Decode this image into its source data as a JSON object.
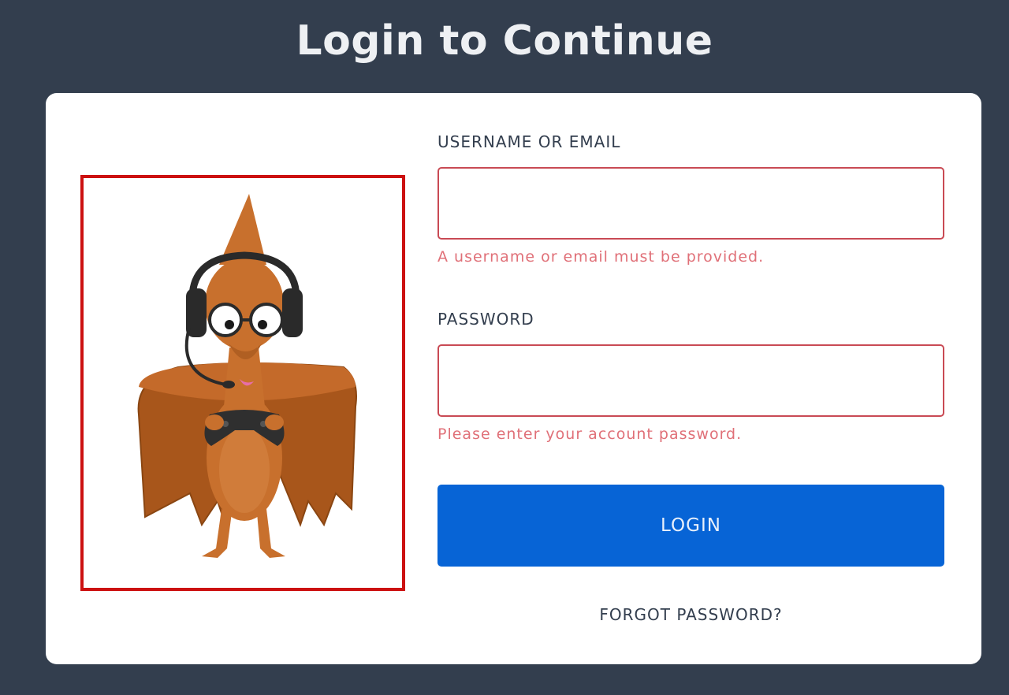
{
  "page": {
    "title": "Login to Continue"
  },
  "mascot": {
    "alt": "Pterodactyl gamer mascot with headset and controller"
  },
  "form": {
    "username": {
      "label": "USERNAME OR EMAIL",
      "value": "",
      "placeholder": "",
      "error": "A username or email must be provided."
    },
    "password": {
      "label": "PASSWORD",
      "value": "",
      "placeholder": "",
      "error": "Please enter your account password."
    },
    "login_label": "LOGIN",
    "forgot_label": "FORGOT PASSWORD?"
  },
  "colors": {
    "background": "#333e4e",
    "card": "#ffffff",
    "accent": "#0764d6",
    "error": "#c94a54",
    "mascot_frame": "#cc1111"
  }
}
